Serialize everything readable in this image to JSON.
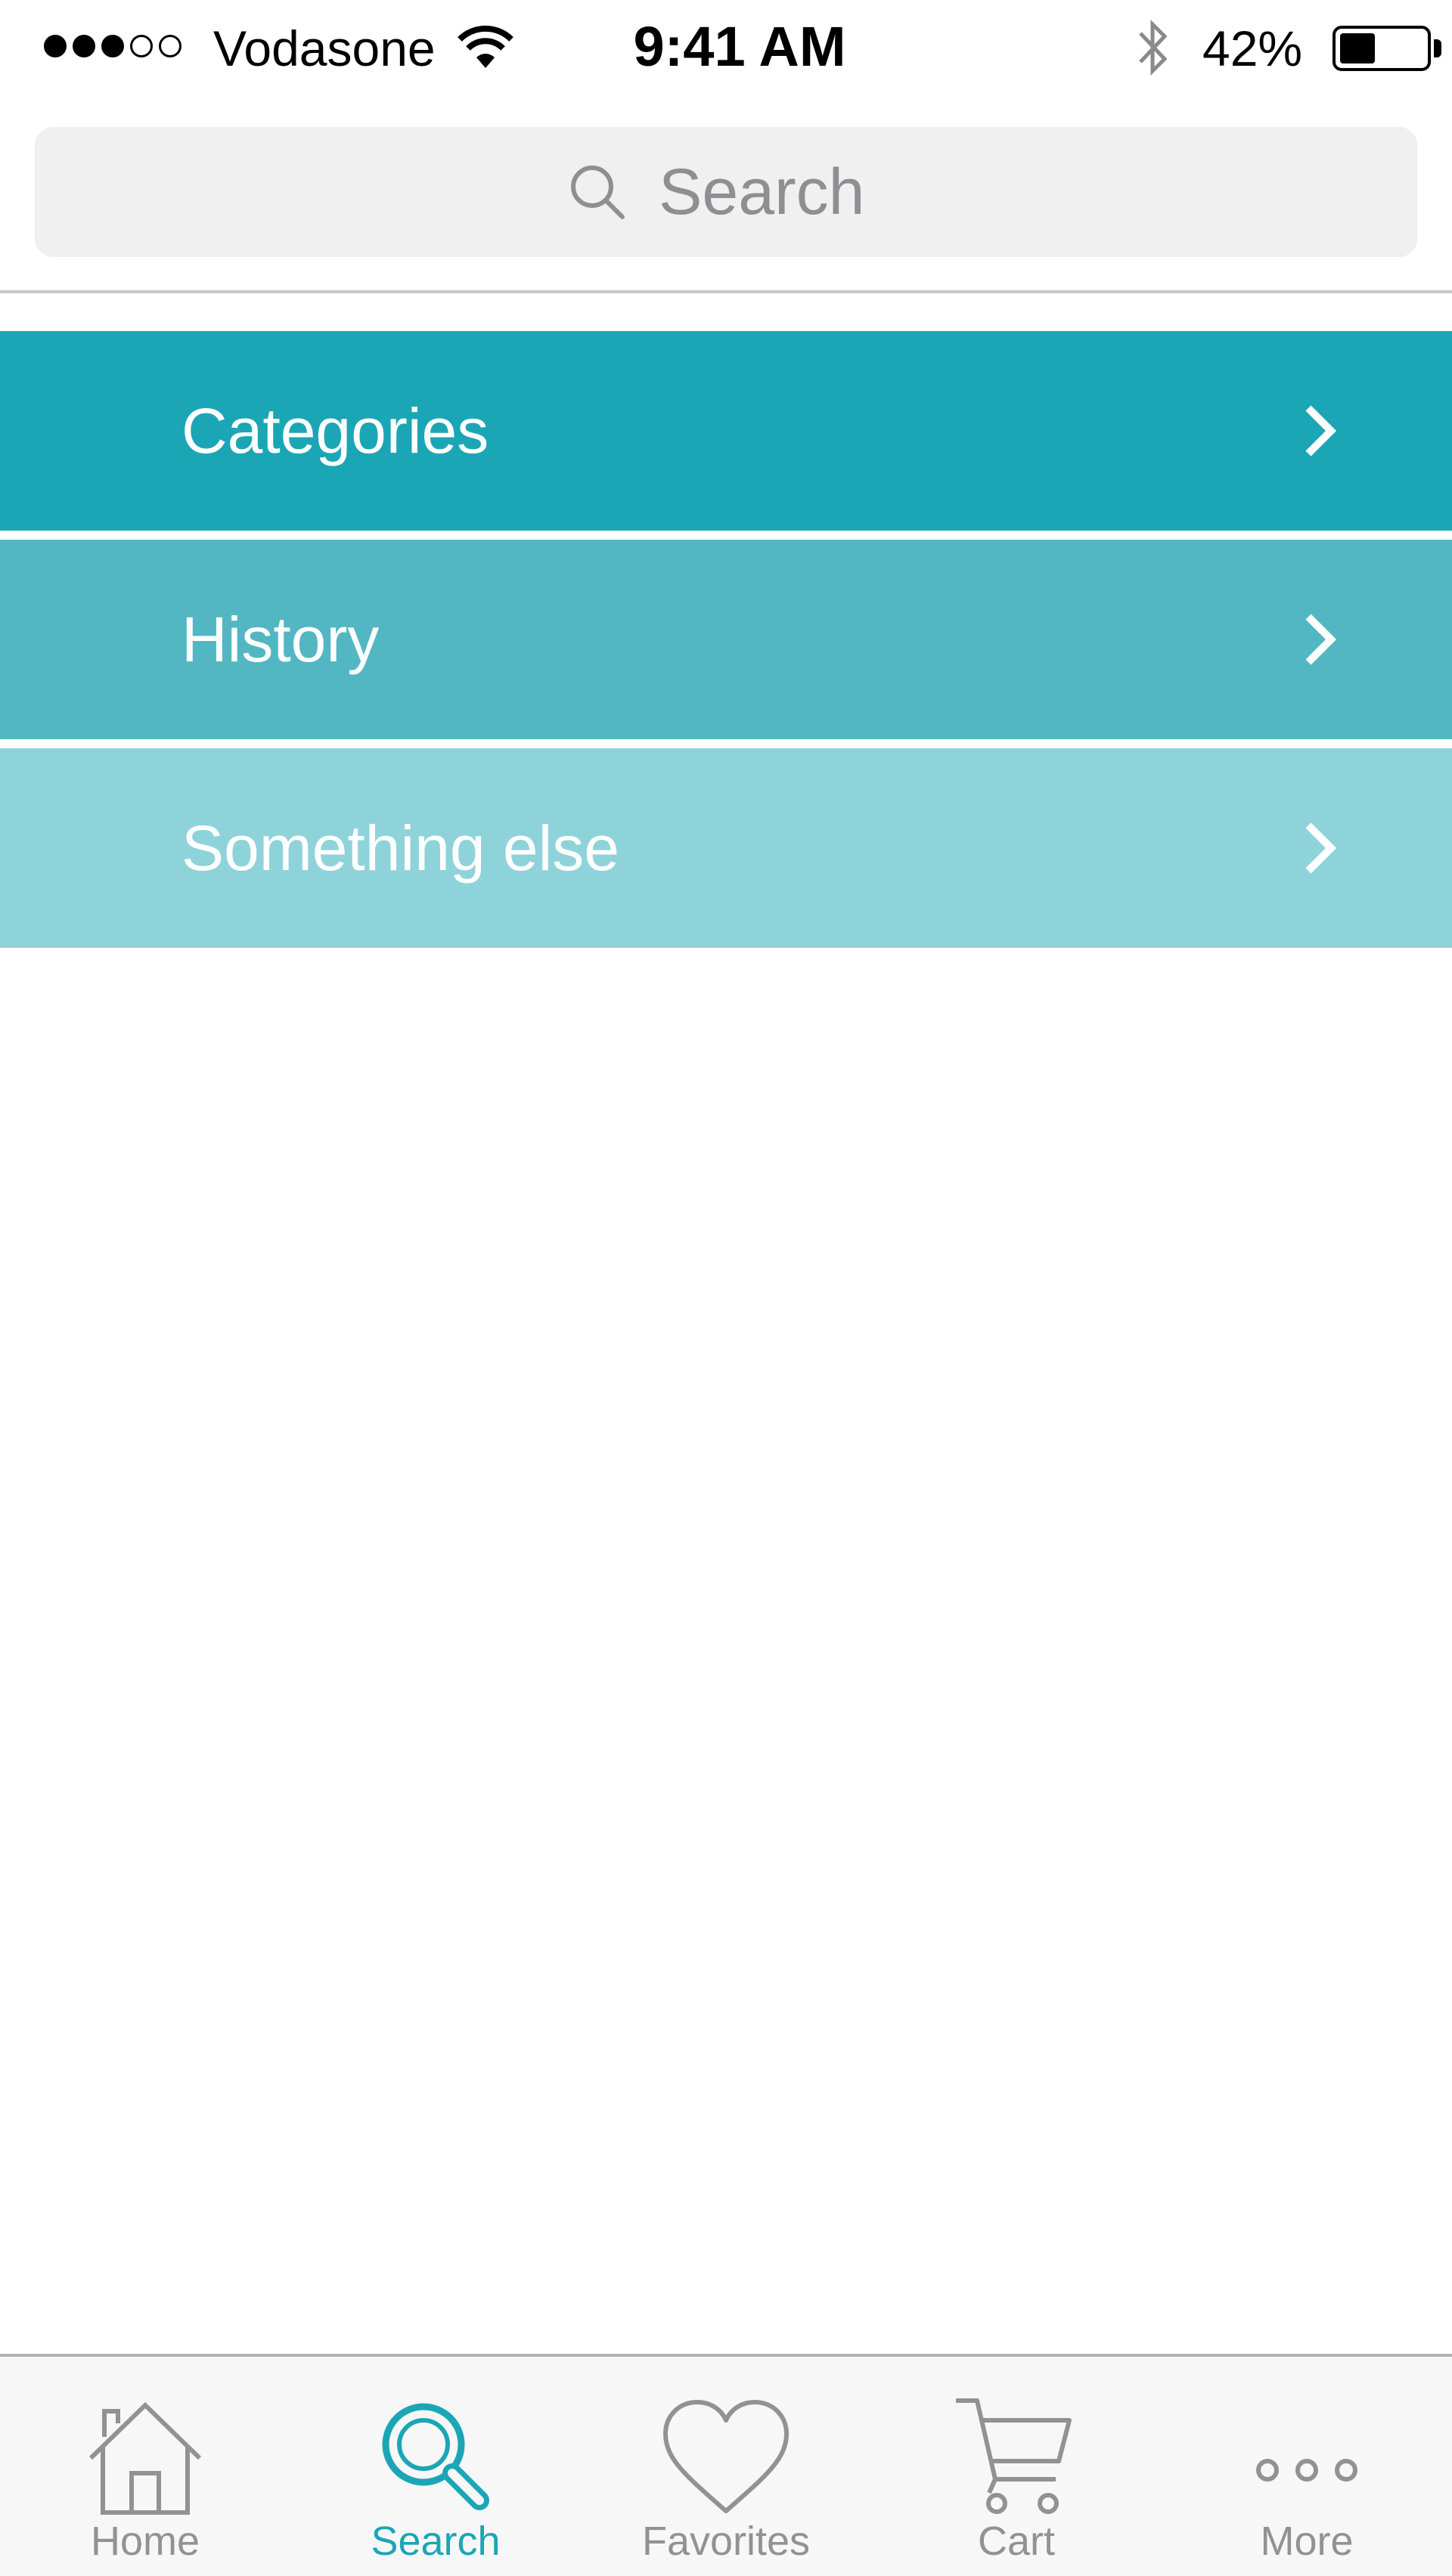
{
  "status_bar": {
    "signal_bars_filled": 3,
    "signal_bars_total": 5,
    "carrier": "Vodasone",
    "wifi_icon": "wifi-icon",
    "time": "9:41 AM",
    "bluetooth_icon": "bluetooth-icon",
    "battery_percent": "42%",
    "battery_level": 0.42
  },
  "search": {
    "placeholder": "Search",
    "icon": "search-icon"
  },
  "menu": {
    "items": [
      {
        "label": "Categories",
        "color": "#1ba6b6",
        "icon": "chevron-right-icon"
      },
      {
        "label": "History",
        "color": "#52b7c2",
        "icon": "chevron-right-icon"
      },
      {
        "label": "Something else",
        "color": "#8fd3da",
        "icon": "chevron-right-icon"
      }
    ]
  },
  "tab_bar": {
    "active_index": 1,
    "active_color": "#1ba6b6",
    "inactive_color": "#929292",
    "tabs": [
      {
        "label": "Home",
        "icon": "home-icon"
      },
      {
        "label": "Search",
        "icon": "search-icon"
      },
      {
        "label": "Favorites",
        "icon": "heart-icon"
      },
      {
        "label": "Cart",
        "icon": "cart-icon"
      },
      {
        "label": "More",
        "icon": "more-icon"
      }
    ]
  }
}
